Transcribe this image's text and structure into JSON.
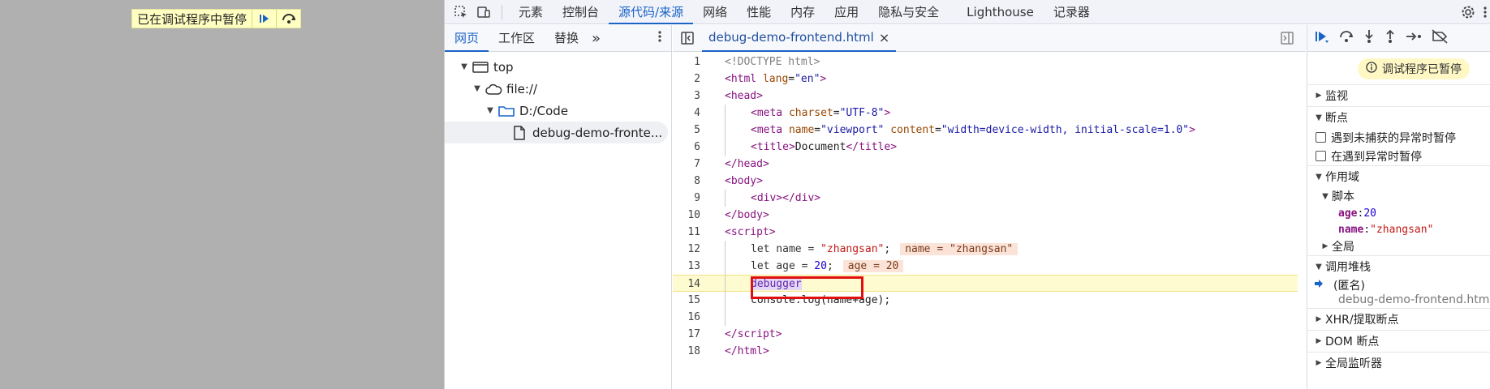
{
  "page_overlay": {
    "paused_text": "已在调试程序中暂停",
    "resume_icon": "resume-icon",
    "step_over_icon": "step-over-icon"
  },
  "top_tabs": {
    "items": [
      "元素",
      "控制台",
      "源代码/来源",
      "网络",
      "性能",
      "内存",
      "应用",
      "隐私与安全",
      "Lighthouse",
      "记录器"
    ],
    "active": "源代码/来源"
  },
  "navigator": {
    "tabs": [
      "网页",
      "工作区",
      "替换"
    ],
    "active": "网页",
    "more": "»",
    "tree": {
      "top": "top",
      "origin": "file://",
      "folder": "D:/Code",
      "file": "debug-demo-fronte..."
    }
  },
  "editor": {
    "tab_label": "debug-demo-frontend.html",
    "close_glyph": "×",
    "paused_line": 14,
    "line_numbers": [
      "1",
      "2",
      "3",
      "4",
      "5",
      "6",
      "7",
      "8",
      "9",
      "10",
      "11",
      "12",
      "13",
      "14",
      "15",
      "16",
      "17",
      "18"
    ],
    "inline_values": {
      "line12": "name = \"zhangsan\"",
      "line13": "age = 20"
    }
  },
  "debugger": {
    "paused_label": "调试程序已暂停",
    "sections": {
      "watch": "监视",
      "breakpoints": "断点",
      "pause_uncaught": "遇到未捕获的异常时暂停",
      "pause_caught": "在遇到异常时暂停",
      "scope": "作用域",
      "script": "脚本",
      "global": "全局",
      "call_stack": "调用堆栈",
      "xhr": "XHR/提取断点",
      "dom": "DOM 断点",
      "global_listeners": "全局监听器"
    },
    "scope_vars": [
      {
        "name": "age",
        "sep": ": ",
        "value": "20"
      },
      {
        "name": "name",
        "sep": ": ",
        "value": "\"zhangsan\""
      }
    ],
    "call_stack": {
      "frame": "(匿名)",
      "location": "debug-demo-frontend.htm"
    }
  },
  "colors": {
    "accent": "#1a63c7",
    "paused_bg": "#fffbd1",
    "highlight_box": "#e01010"
  }
}
